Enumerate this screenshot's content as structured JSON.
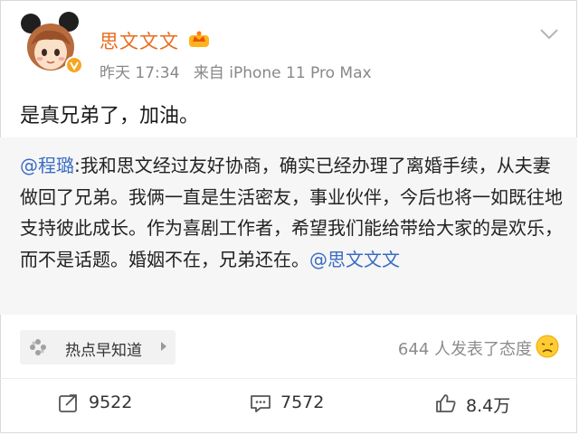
{
  "post": {
    "author": "思文文文",
    "time": "昨天 17:34",
    "source": "来自 iPhone 11 Pro Max",
    "text": "是真兄弟了，加油。"
  },
  "quote": {
    "mention_start": "@程璐",
    "text": ":我和思文经过友好协商，确实已经办理了离婚手续，从夫妻做回了兄弟。我俩一直是生活密友，事业伙伴，今后也将一如既往地支持彼此成长。作为喜剧工作者，希望我们能给带给大家的是欢乐，而不是话题。婚姻不在，兄弟还在。",
    "mention_end": "@思文文文"
  },
  "topic": {
    "label": "热点早知道"
  },
  "attitude": {
    "text": "644 人发表了态度"
  },
  "actions": {
    "repost_count": "9522",
    "comment_count": "7572",
    "like_count": "8.4万"
  },
  "colors": {
    "author_name": "#e86c1d",
    "mention": "#3a6cc4",
    "quote_bg": "#f6f6f6"
  },
  "icons": {
    "avatar": "cartoon-girl-mouse-ears-avatar",
    "vip": "crown-badge-icon",
    "verified": "verified-v-icon",
    "more": "chevron-down-icon",
    "topic": "hot-topic-icon",
    "attitude": "sad-face-emoji-icon",
    "repost": "repost-icon",
    "comment": "comment-icon",
    "like": "thumbs-up-icon"
  }
}
